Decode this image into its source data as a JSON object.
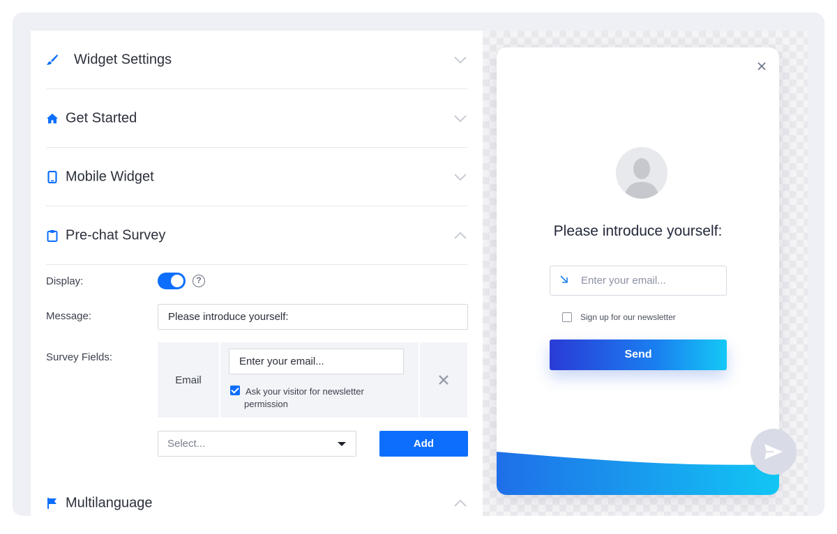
{
  "sections": {
    "widget_settings": "Widget Settings",
    "get_started": "Get Started",
    "mobile_widget": "Mobile Widget",
    "prechat_survey": "Pre-chat Survey",
    "multilanguage": "Multilanguage"
  },
  "survey": {
    "display_label": "Display:",
    "display_on": true,
    "message_label": "Message:",
    "message_value": "Please introduce yourself:",
    "fields_label": "Survey Fields:",
    "field_type": "Email",
    "field_placeholder": "Enter your email...",
    "newsletter_checked": true,
    "newsletter_line1": "Ask your visitor for newsletter",
    "newsletter_line2": "permission",
    "select_placeholder": "Select...",
    "add_label": "Add"
  },
  "preview": {
    "title": "Please introduce yourself:",
    "email_placeholder": "Enter your email...",
    "newsletter_label": "Sign up for our newsletter",
    "send_label": "Send"
  },
  "colors": {
    "accent": "#0d6efd",
    "gradient_start": "#2a3bd6",
    "gradient_end": "#14c9f5"
  }
}
